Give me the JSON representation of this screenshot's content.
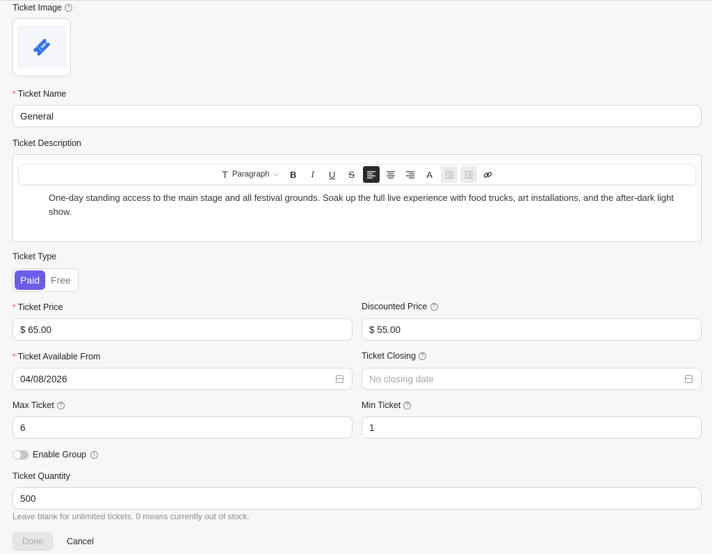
{
  "ticket_image": {
    "label": "Ticket Image",
    "icon": "ticket-icon",
    "accent": "#2f6fe4"
  },
  "ticket_name": {
    "label": "Ticket Name",
    "value": "General"
  },
  "ticket_description": {
    "label": "Ticket Description",
    "toolbar": {
      "paragraph": "Paragraph",
      "bold": "B",
      "italic": "I",
      "underline": "U",
      "strike": "S",
      "text_color": "A"
    },
    "text": "One-day standing access to the main stage and all festival grounds. Soak up the full live experience with food trucks, art installations, and the after-dark light show."
  },
  "ticket_type": {
    "label": "Ticket Type",
    "options": [
      "Paid",
      "Free"
    ],
    "selected": "Paid",
    "accent": "#6b5de8"
  },
  "ticket_price": {
    "label": "Ticket Price",
    "value": "$ 65.00"
  },
  "discounted_price": {
    "label": "Discounted Price",
    "value": "$ 55.00"
  },
  "available_from": {
    "label": "Ticket Available From",
    "value": "04/08/2026"
  },
  "ticket_closing": {
    "label": "Ticket Closing",
    "placeholder": "No closing date"
  },
  "max_ticket": {
    "label": "Max Ticket",
    "value": "6"
  },
  "min_ticket": {
    "label": "Min Ticket",
    "value": "1"
  },
  "enable_group": {
    "label": "Enable Group",
    "enabled": false
  },
  "ticket_quantity": {
    "label": "Ticket Quantity",
    "value": "500",
    "hint": "Leave blank for unlimited tickets. 0 means currently out of stock."
  },
  "actions": {
    "done": "Done",
    "cancel": "Cancel"
  },
  "info_glyph": "i",
  "help_glyph": "?",
  "required_mark": "*"
}
